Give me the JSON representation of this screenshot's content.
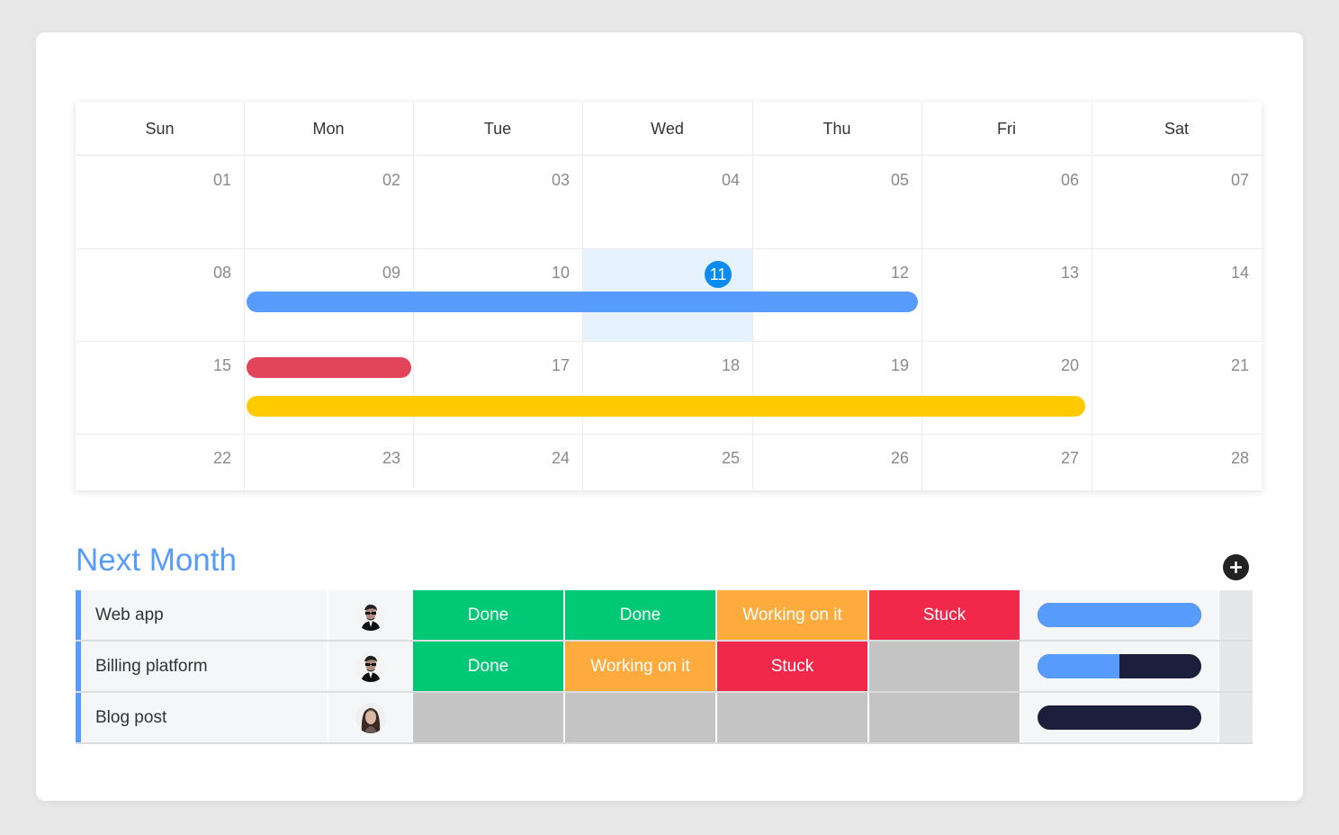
{
  "calendar": {
    "days": [
      "Sun",
      "Mon",
      "Tue",
      "Wed",
      "Thu",
      "Fri",
      "Sat"
    ],
    "weeks": [
      [
        "01",
        "02",
        "03",
        "04",
        "05",
        "06",
        "07"
      ],
      [
        "08",
        "09",
        "10",
        "11",
        "12",
        "13",
        "14"
      ],
      [
        "15",
        "16",
        "17",
        "18",
        "19",
        "20",
        "21"
      ],
      [
        "22",
        "23",
        "24",
        "25",
        "26",
        "27",
        "28"
      ]
    ],
    "today": "11",
    "events": [
      {
        "name": "blue-event",
        "color": "#579bfc"
      },
      {
        "name": "red-event",
        "color": "#e2445c"
      },
      {
        "name": "yellow-event",
        "color": "#ffcb00"
      }
    ]
  },
  "table": {
    "title": "Next Month",
    "rows": [
      {
        "name": "Web app",
        "avatar": "man-glasses",
        "statuses": [
          "Done",
          "Done",
          "Working on it",
          "Stuck"
        ],
        "progress": 1.0
      },
      {
        "name": "Billing platform",
        "avatar": "man-glasses",
        "statuses": [
          "Done",
          "Working on it",
          "Stuck",
          ""
        ],
        "progress": 0.5
      },
      {
        "name": "Blog post",
        "avatar": "woman",
        "statuses": [
          "",
          "",
          "",
          ""
        ],
        "progress": 0.0
      }
    ]
  },
  "colors": {
    "Done": "#00c875",
    "Working on it": "#fdab3d",
    "Stuck": "#f2284b",
    "empty": "#c4c4c4",
    "accent": "#579bfc"
  }
}
